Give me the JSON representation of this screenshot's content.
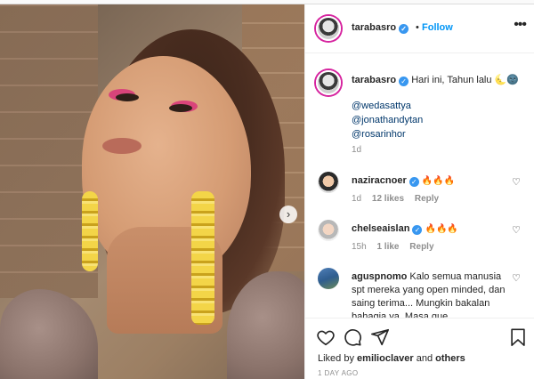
{
  "post": {
    "username": "tarabasro",
    "separator": "•",
    "follow_label": "Follow",
    "more_glyph": "•••",
    "next_glyph": "›"
  },
  "caption": {
    "username": "tarabasro",
    "text": "Hari ini, Tahun lalu",
    "emoji": "🌜🌚",
    "tags": [
      "@wedasattya",
      "@jonathandytan",
      "@rosarinhor"
    ],
    "time": "1d"
  },
  "comments": [
    {
      "username": "naziracnoer",
      "text": "🔥🔥🔥",
      "time": "1d",
      "likes": "12 likes",
      "reply": "Reply"
    },
    {
      "username": "chelseaislan",
      "text": "🔥🔥🔥",
      "time": "15h",
      "likes": "1 like",
      "reply": "Reply"
    },
    {
      "username": "aguspnomo",
      "text": "Kalo semua manusia spt mereka yang open minded, dan saing terima... Mungkin bakalan bahagia ya. Masa que",
      "time": "",
      "likes": "",
      "reply": ""
    }
  ],
  "footer": {
    "liked_by_prefix": "Liked by",
    "liked_by_user": "emilioclaver",
    "liked_by_mid": "and",
    "liked_by_others": "others",
    "date": "1 DAY AGO"
  },
  "colors": {
    "link": "#0095f6",
    "verified": "#3897f0",
    "muted": "#8e8e8e",
    "tag": "#00376b"
  },
  "icons": [
    "verified-badge-icon",
    "heart-icon",
    "comment-icon",
    "share-icon",
    "bookmark-icon",
    "more-icon",
    "chevron-right-icon"
  ]
}
